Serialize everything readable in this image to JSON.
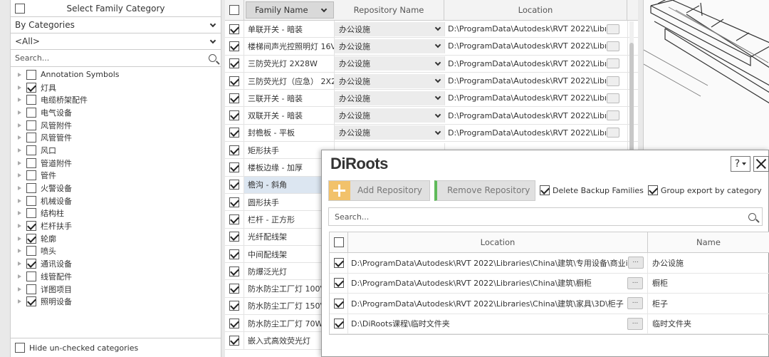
{
  "left_panel": {
    "header": "Select Family Category",
    "filter_by": "By Categories",
    "filter_value": "<All>",
    "search_placeholder": "Search...",
    "categories": [
      {
        "label": "Annotation Symbols",
        "checked": false
      },
      {
        "label": "灯具",
        "checked": true
      },
      {
        "label": "电缆桥架配件",
        "checked": false
      },
      {
        "label": "电气设备",
        "checked": false
      },
      {
        "label": "风管附件",
        "checked": false
      },
      {
        "label": "风管管件",
        "checked": false
      },
      {
        "label": "风口",
        "checked": false
      },
      {
        "label": "管道附件",
        "checked": false
      },
      {
        "label": "管件",
        "checked": false
      },
      {
        "label": "火警设备",
        "checked": false
      },
      {
        "label": "机械设备",
        "checked": false
      },
      {
        "label": "结构柱",
        "checked": false
      },
      {
        "label": "栏杆扶手",
        "checked": true
      },
      {
        "label": "轮廓",
        "checked": true
      },
      {
        "label": "喷头",
        "checked": false
      },
      {
        "label": "通讯设备",
        "checked": true
      },
      {
        "label": "线管配件",
        "checked": false
      },
      {
        "label": "详图项目",
        "checked": false
      },
      {
        "label": "照明设备",
        "checked": true
      }
    ],
    "hide_unchecked_label": "Hide un-checked categories"
  },
  "grid": {
    "columns": [
      "Family Name",
      "Repository Name",
      "Location"
    ],
    "rows": [
      {
        "name": "单联开关 - 暗装",
        "repo": "办公设施",
        "location": "D:\\ProgramData\\Autodesk\\RVT 2022\\Libı",
        "checked": true
      },
      {
        "name": "楼梯间声光控照明灯 16V",
        "repo": "办公设施",
        "location": "D:\\ProgramData\\Autodesk\\RVT 2022\\Libı",
        "checked": true
      },
      {
        "name": "三防荧光灯 2X28W",
        "repo": "办公设施",
        "location": "D:\\ProgramData\\Autodesk\\RVT 2022\\Libı",
        "checked": true
      },
      {
        "name": "三防荧光灯（应急） 2X2",
        "repo": "办公设施",
        "location": "D:\\ProgramData\\Autodesk\\RVT 2022\\Libı",
        "checked": true
      },
      {
        "name": "三联开关 - 暗装",
        "repo": "办公设施",
        "location": "D:\\ProgramData\\Autodesk\\RVT 2022\\Libı",
        "checked": true
      },
      {
        "name": "双联开关 - 暗装",
        "repo": "办公设施",
        "location": "D:\\ProgramData\\Autodesk\\RVT 2022\\Libı",
        "checked": true
      },
      {
        "name": "封檐板 - 平板",
        "repo": "办公设施",
        "location": "D:\\ProgramData\\Autodesk\\RVT 2022\\Libı",
        "checked": true
      },
      {
        "name": "矩形扶手",
        "repo": "",
        "location": "",
        "checked": true
      },
      {
        "name": "楼板边缘 - 加厚",
        "repo": "",
        "location": "",
        "checked": true
      },
      {
        "name": "檐沟 - 斜角",
        "repo": "",
        "location": "",
        "checked": true
      },
      {
        "name": "圆形扶手",
        "repo": "",
        "location": "",
        "checked": true
      },
      {
        "name": "栏杆 - 正方形",
        "repo": "",
        "location": "",
        "checked": true
      },
      {
        "name": "光纤配线架",
        "repo": "",
        "location": "",
        "checked": true
      },
      {
        "name": "中间配线架",
        "repo": "",
        "location": "",
        "checked": true
      },
      {
        "name": "防爆泛光灯",
        "repo": "",
        "location": "",
        "checked": true
      },
      {
        "name": "防水防尘工厂灯 100V",
        "repo": "",
        "location": "",
        "checked": true
      },
      {
        "name": "防水防尘工厂灯 150V",
        "repo": "",
        "location": "",
        "checked": true
      },
      {
        "name": "防水防尘工厂灯 70W",
        "repo": "",
        "location": "",
        "checked": true
      },
      {
        "name": "嵌入式高效荧光灯",
        "repo": "",
        "location": "",
        "checked": true
      }
    ],
    "selected_row": 9
  },
  "dialog": {
    "logo": "DiRoots",
    "help_label": "?",
    "add_repository": "Add Repository",
    "remove_repository": "Remove Repository",
    "delete_backup_families": "Delete Backup Families",
    "group_export_by_category": "Group export by category",
    "search_placeholder": "Search...",
    "columns": [
      "Location",
      "Name"
    ],
    "rows": [
      {
        "location": "D:\\ProgramData\\Autodesk\\RVT 2022\\Libraries\\China\\建筑\\专用设备\\商业i",
        "name": "办公设施",
        "checked": true
      },
      {
        "location": "D:\\ProgramData\\Autodesk\\RVT 2022\\Libraries\\China\\建筑\\橱柜",
        "name": "橱柜",
        "checked": true
      },
      {
        "location": "D:\\ProgramData\\Autodesk\\RVT 2022\\Libraries\\China\\建筑\\家具\\3D\\柜子",
        "name": "柜子",
        "checked": true
      },
      {
        "location": "D:\\DiRoots课程\\临时文件夹",
        "name": "临时文件夹",
        "checked": true
      }
    ]
  }
}
